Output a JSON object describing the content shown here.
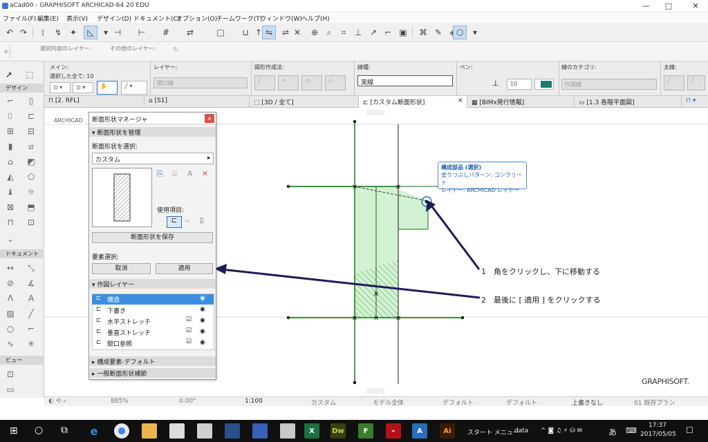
{
  "window": {
    "title": "aCad00 - GRAPHISOFT ARCHICAD-64 20 EDU",
    "minimize": "—",
    "maximize": "□",
    "close": "✕"
  },
  "menu": [
    "ファイル(F)",
    "編集(E)",
    "表示(V)",
    "デザイン(D)",
    "ドキュメント(C)",
    "オプション(O)",
    "チームワーク(T)",
    "ウィンドウ(W)",
    "ヘルプ(H)"
  ],
  "toolbar2": {
    "layer_label": "選択内容のレイヤー:",
    "other_layer_label": "その他のレイヤー:"
  },
  "toolbox": {
    "design_header": "デザイン",
    "document_header": "ドキュメント",
    "view_header": "ビュー"
  },
  "infobox": {
    "main_label": "メイン:",
    "selected_label": "選択した全て: 10",
    "layer_label": "レイヤー:",
    "layer_value": "開口線",
    "geometry_label": "図形作成法:",
    "linetype_label": "線種:",
    "linetype_value": "実線",
    "pen_label": "ペン:",
    "pen_value": "10",
    "graphic_label": "線のカテゴリ:",
    "graphic_value": "作図線",
    "thickness_label": "太線:"
  },
  "tabs": [
    {
      "label": "[2. RFL]"
    },
    {
      "label": "[S1]"
    },
    {
      "label": "[3D / 全て]"
    },
    {
      "label": "[カスタム断面形状]",
      "close": "×"
    },
    {
      "label": "[BIMx発行情報]"
    },
    {
      "label": "[1.3 各階平面図]"
    }
  ],
  "panel": {
    "title": "断面形状マネージャ",
    "close": "x",
    "section_manage": "断面形状を管理",
    "select_label": "断面形状を選択:",
    "select_value": "カスタム",
    "use_label": "使用項目:",
    "save_button": "断面形状を保存",
    "edit_label": "要素選択:",
    "cancel_button": "取消",
    "apply_button": "適用",
    "section_layers": "作図レイヤー",
    "layers": [
      {
        "name": "構造",
        "selected": true,
        "checked": false
      },
      {
        "name": "下書き",
        "selected": false,
        "checked": false
      },
      {
        "name": "水平ストレッチ",
        "selected": false,
        "checked": true
      },
      {
        "name": "垂直ストレッチ",
        "selected": false,
        "checked": true
      },
      {
        "name": "開口参照",
        "selected": false,
        "checked": true
      }
    ],
    "section_defaults": "構成要素-デフォルト",
    "section_general": "一般断面形状補節"
  },
  "canvas": {
    "archicad_label": "ARCHICAD",
    "tooltip_line1": "構成部品 (選択)",
    "tooltip_line2": "塗りつぶしパターン: コンクリート",
    "tooltip_line3": "レイヤー: ARCHICAD レイヤー",
    "annotation1": "1　角をクリックし、下に移動する",
    "annotation2": "2　最後に [ 適用 ] をクリックする",
    "brand": "GRAPHISOFT.",
    "colors": {
      "line": "#0a6e0a",
      "fill": "#c8efc8",
      "arrow": "#1c1c5a"
    }
  },
  "status": {
    "zoom": "885%",
    "angle": "0.00°",
    "scale": "1:100",
    "layer_combo": "カスタム",
    "model": "モデル全体",
    "pen": "デフォルト",
    "dim": "デフォルト",
    "override": "上書きなし",
    "renovation": "01 既存プラン"
  },
  "taskbar": {
    "start_menu": "スタート メニュー",
    "data": "data",
    "lang": "あ",
    "time": "17:37",
    "date": "2017/05/05"
  }
}
